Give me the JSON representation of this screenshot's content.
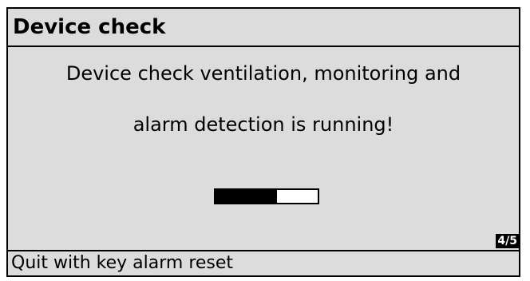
{
  "header": {
    "title": "Device check"
  },
  "message": {
    "line1": "Device check ventilation, monitoring and",
    "line2": "alarm detection is running!"
  },
  "progress": {
    "fraction": 0.6
  },
  "pager": {
    "label": "4/5"
  },
  "footer": {
    "hint": "Quit with key alarm reset"
  },
  "colors": {
    "background": "#dcdcdc",
    "foreground": "#000000"
  }
}
